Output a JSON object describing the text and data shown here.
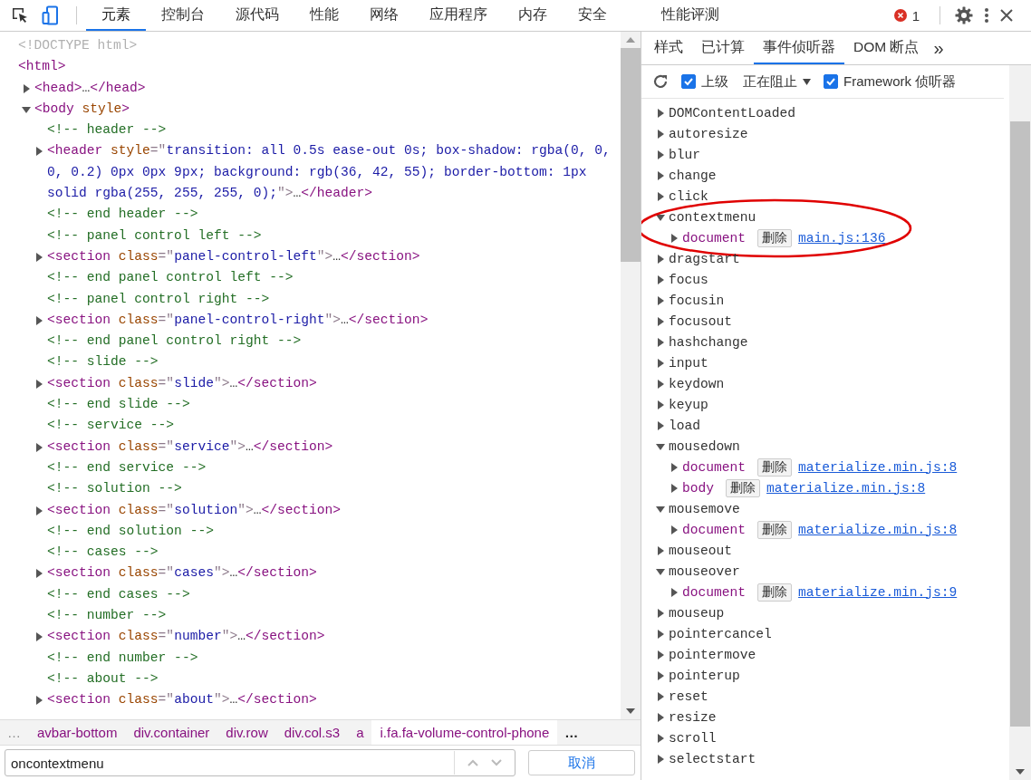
{
  "toolbar": {
    "tabs": [
      {
        "label": "元素",
        "selected": true
      },
      {
        "label": "控制台",
        "selected": false
      },
      {
        "label": "源代码",
        "selected": false
      },
      {
        "label": "性能",
        "selected": false
      },
      {
        "label": "网络",
        "selected": false
      },
      {
        "label": "应用程序",
        "selected": false
      },
      {
        "label": "内存",
        "selected": false
      },
      {
        "label": "安全",
        "selected": false
      },
      {
        "label": "性能评测",
        "selected": false
      }
    ],
    "error_count": "1"
  },
  "elements": {
    "tree": [
      {
        "parts": [
          {
            "kind": "doctype",
            "text": "<!DOCTYPE html>"
          }
        ]
      },
      {
        "parts": [
          {
            "kind": "tag",
            "text": "<html>"
          }
        ],
        "children": [
          {
            "expanded": false,
            "parts": [
              {
                "kind": "tag",
                "text": "<head>"
              },
              {
                "kind": "text",
                "text": "…"
              },
              {
                "kind": "tag",
                "text": "</head>"
              }
            ]
          },
          {
            "expanded": true,
            "parts": [
              {
                "kind": "tag",
                "text": "<body"
              },
              {
                "kind": "attr",
                "text": " style"
              },
              {
                "kind": "tag",
                "text": ">"
              }
            ],
            "children": [
              {
                "parts": [
                  {
                    "kind": "comment",
                    "text": "<!-- header -->"
                  }
                ]
              },
              {
                "expanded": false,
                "parts": [
                  {
                    "kind": "tag",
                    "text": "<header"
                  },
                  {
                    "kind": "attr",
                    "text": " style"
                  },
                  {
                    "kind": "punct",
                    "text": "=\""
                  },
                  {
                    "kind": "value",
                    "text": "transition: all 0.5s ease-out 0s; box-shadow: rgba(0, 0, 0, 0.2) 0px 0px 9px; background: rgb(36, 42, 55); border-bottom: 1px solid rgba(255, 255, 255, 0);"
                  },
                  {
                    "kind": "punct",
                    "text": "\">"
                  },
                  {
                    "kind": "text",
                    "text": "…"
                  },
                  {
                    "kind": "tag",
                    "text": "</header>"
                  }
                ]
              },
              {
                "parts": [
                  {
                    "kind": "comment",
                    "text": "<!-- end header -->"
                  }
                ]
              },
              {
                "parts": [
                  {
                    "kind": "comment",
                    "text": "<!-- panel control left -->"
                  }
                ]
              },
              {
                "expanded": false,
                "parts": [
                  {
                    "kind": "tag",
                    "text": "<section"
                  },
                  {
                    "kind": "attr",
                    "text": " class"
                  },
                  {
                    "kind": "punct",
                    "text": "=\""
                  },
                  {
                    "kind": "value",
                    "text": "panel-control-left"
                  },
                  {
                    "kind": "punct",
                    "text": "\">"
                  },
                  {
                    "kind": "text",
                    "text": "…"
                  },
                  {
                    "kind": "tag",
                    "text": "</section>"
                  }
                ]
              },
              {
                "parts": [
                  {
                    "kind": "comment",
                    "text": "<!-- end panel control left -->"
                  }
                ]
              },
              {
                "parts": [
                  {
                    "kind": "comment",
                    "text": "<!-- panel control right -->"
                  }
                ]
              },
              {
                "expanded": false,
                "parts": [
                  {
                    "kind": "tag",
                    "text": "<section"
                  },
                  {
                    "kind": "attr",
                    "text": " class"
                  },
                  {
                    "kind": "punct",
                    "text": "=\""
                  },
                  {
                    "kind": "value",
                    "text": "panel-control-right"
                  },
                  {
                    "kind": "punct",
                    "text": "\">"
                  },
                  {
                    "kind": "text",
                    "text": "…"
                  },
                  {
                    "kind": "tag",
                    "text": "</section>"
                  }
                ]
              },
              {
                "parts": [
                  {
                    "kind": "comment",
                    "text": "<!-- end panel control right -->"
                  }
                ]
              },
              {
                "parts": [
                  {
                    "kind": "comment",
                    "text": "<!-- slide -->"
                  }
                ]
              },
              {
                "expanded": false,
                "parts": [
                  {
                    "kind": "tag",
                    "text": "<section"
                  },
                  {
                    "kind": "attr",
                    "text": " class"
                  },
                  {
                    "kind": "punct",
                    "text": "=\""
                  },
                  {
                    "kind": "value",
                    "text": "slide"
                  },
                  {
                    "kind": "punct",
                    "text": "\">"
                  },
                  {
                    "kind": "text",
                    "text": "…"
                  },
                  {
                    "kind": "tag",
                    "text": "</section>"
                  }
                ]
              },
              {
                "parts": [
                  {
                    "kind": "comment",
                    "text": "<!-- end slide -->"
                  }
                ]
              },
              {
                "parts": [
                  {
                    "kind": "comment",
                    "text": "<!-- service -->"
                  }
                ]
              },
              {
                "expanded": false,
                "parts": [
                  {
                    "kind": "tag",
                    "text": "<section"
                  },
                  {
                    "kind": "attr",
                    "text": " class"
                  },
                  {
                    "kind": "punct",
                    "text": "=\""
                  },
                  {
                    "kind": "value",
                    "text": "service"
                  },
                  {
                    "kind": "punct",
                    "text": "\">"
                  },
                  {
                    "kind": "text",
                    "text": "…"
                  },
                  {
                    "kind": "tag",
                    "text": "</section>"
                  }
                ]
              },
              {
                "parts": [
                  {
                    "kind": "comment",
                    "text": "<!-- end service -->"
                  }
                ]
              },
              {
                "parts": [
                  {
                    "kind": "comment",
                    "text": "<!-- solution -->"
                  }
                ]
              },
              {
                "expanded": false,
                "parts": [
                  {
                    "kind": "tag",
                    "text": "<section"
                  },
                  {
                    "kind": "attr",
                    "text": " class"
                  },
                  {
                    "kind": "punct",
                    "text": "=\""
                  },
                  {
                    "kind": "value",
                    "text": "solution"
                  },
                  {
                    "kind": "punct",
                    "text": "\">"
                  },
                  {
                    "kind": "text",
                    "text": "…"
                  },
                  {
                    "kind": "tag",
                    "text": "</section>"
                  }
                ]
              },
              {
                "parts": [
                  {
                    "kind": "comment",
                    "text": "<!-- end solution -->"
                  }
                ]
              },
              {
                "parts": [
                  {
                    "kind": "comment",
                    "text": "<!-- cases -->"
                  }
                ]
              },
              {
                "expanded": false,
                "parts": [
                  {
                    "kind": "tag",
                    "text": "<section"
                  },
                  {
                    "kind": "attr",
                    "text": " class"
                  },
                  {
                    "kind": "punct",
                    "text": "=\""
                  },
                  {
                    "kind": "value",
                    "text": "cases"
                  },
                  {
                    "kind": "punct",
                    "text": "\">"
                  },
                  {
                    "kind": "text",
                    "text": "…"
                  },
                  {
                    "kind": "tag",
                    "text": "</section>"
                  }
                ]
              },
              {
                "parts": [
                  {
                    "kind": "comment",
                    "text": "<!-- end cases -->"
                  }
                ]
              },
              {
                "parts": [
                  {
                    "kind": "comment",
                    "text": "<!-- number -->"
                  }
                ]
              },
              {
                "expanded": false,
                "parts": [
                  {
                    "kind": "tag",
                    "text": "<section"
                  },
                  {
                    "kind": "attr",
                    "text": " class"
                  },
                  {
                    "kind": "punct",
                    "text": "=\""
                  },
                  {
                    "kind": "value",
                    "text": "number"
                  },
                  {
                    "kind": "punct",
                    "text": "\">"
                  },
                  {
                    "kind": "text",
                    "text": "…"
                  },
                  {
                    "kind": "tag",
                    "text": "</section>"
                  }
                ]
              },
              {
                "parts": [
                  {
                    "kind": "comment",
                    "text": "<!-- end number -->"
                  }
                ]
              },
              {
                "parts": [
                  {
                    "kind": "comment",
                    "text": "<!-- about -->"
                  }
                ]
              },
              {
                "expanded": false,
                "parts": [
                  {
                    "kind": "tag",
                    "text": "<section"
                  },
                  {
                    "kind": "attr",
                    "text": " class"
                  },
                  {
                    "kind": "punct",
                    "text": "=\""
                  },
                  {
                    "kind": "value",
                    "text": "about"
                  },
                  {
                    "kind": "punct",
                    "text": "\">"
                  },
                  {
                    "kind": "text",
                    "text": "…"
                  },
                  {
                    "kind": "tag",
                    "text": "</section>"
                  }
                ]
              }
            ]
          }
        ]
      }
    ],
    "breadcrumbs": {
      "more_left": "…",
      "items": [
        {
          "label": "avbar-bottom",
          "selected": false
        },
        {
          "label": "div.container",
          "selected": false
        },
        {
          "label": "div.row",
          "selected": false
        },
        {
          "label": "div.col.s3",
          "selected": false
        },
        {
          "label": "a",
          "selected": false
        },
        {
          "label": "i.fa.fa-volume-control-phone",
          "selected": true
        }
      ],
      "more_right": "…"
    },
    "search": {
      "value": "oncontextmenu",
      "cancel": "取消"
    }
  },
  "sidebar": {
    "tabs": [
      {
        "label": "样式",
        "selected": false
      },
      {
        "label": "已计算",
        "selected": false
      },
      {
        "label": "事件侦听器",
        "selected": true
      },
      {
        "label": "DOM 断点",
        "selected": false
      }
    ],
    "more": "»",
    "options": {
      "ancestors": {
        "label": "上级",
        "checked": true
      },
      "blocking": {
        "label": "正在阻止"
      },
      "framework": {
        "label": "Framework 侦听器",
        "checked": true
      }
    },
    "events": [
      {
        "name": "DOMContentLoaded",
        "expanded": false
      },
      {
        "name": "autoresize",
        "expanded": false
      },
      {
        "name": "blur",
        "expanded": false
      },
      {
        "name": "change",
        "expanded": false
      },
      {
        "name": "click",
        "expanded": false
      },
      {
        "name": "contextmenu",
        "expanded": true,
        "highlighted": true,
        "listeners": [
          {
            "target": "document",
            "remove": "删除",
            "source": "main.js:136"
          }
        ]
      },
      {
        "name": "dragstart",
        "expanded": false
      },
      {
        "name": "focus",
        "expanded": false
      },
      {
        "name": "focusin",
        "expanded": false
      },
      {
        "name": "focusout",
        "expanded": false
      },
      {
        "name": "hashchange",
        "expanded": false
      },
      {
        "name": "input",
        "expanded": false
      },
      {
        "name": "keydown",
        "expanded": false
      },
      {
        "name": "keyup",
        "expanded": false
      },
      {
        "name": "load",
        "expanded": false
      },
      {
        "name": "mousedown",
        "expanded": true,
        "listeners": [
          {
            "target": "document",
            "remove": "删除",
            "source": "materialize.min.js:8"
          },
          {
            "target": "body",
            "remove": "删除",
            "source": "materialize.min.js:8"
          }
        ]
      },
      {
        "name": "mousemove",
        "expanded": true,
        "listeners": [
          {
            "target": "document",
            "remove": "删除",
            "source": "materialize.min.js:8"
          }
        ]
      },
      {
        "name": "mouseout",
        "expanded": false
      },
      {
        "name": "mouseover",
        "expanded": true,
        "listeners": [
          {
            "target": "document",
            "remove": "删除",
            "source": "materialize.min.js:9"
          }
        ]
      },
      {
        "name": "mouseup",
        "expanded": false
      },
      {
        "name": "pointercancel",
        "expanded": false
      },
      {
        "name": "pointermove",
        "expanded": false
      },
      {
        "name": "pointerup",
        "expanded": false
      },
      {
        "name": "reset",
        "expanded": false
      },
      {
        "name": "resize",
        "expanded": false
      },
      {
        "name": "scroll",
        "expanded": false
      },
      {
        "name": "selectstart",
        "expanded": false
      }
    ]
  }
}
